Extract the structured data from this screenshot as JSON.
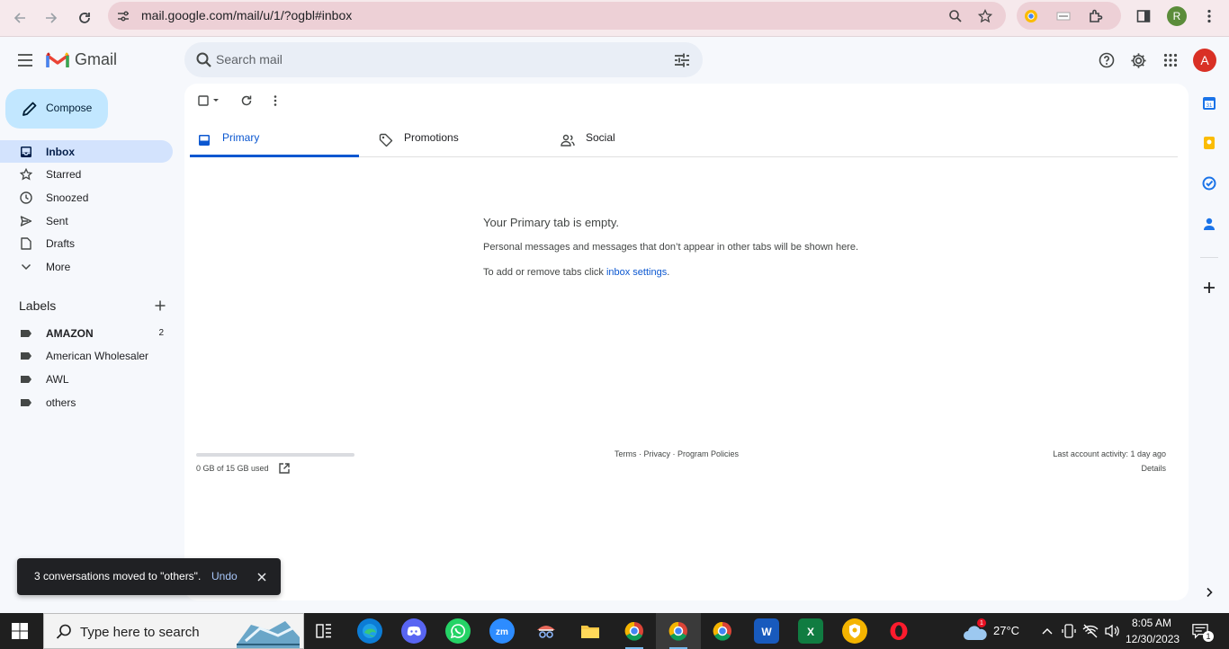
{
  "browser": {
    "url": "mail.google.com/mail/u/1/?ogbl#inbox",
    "profile_initial": "R"
  },
  "header": {
    "app_name": "Gmail",
    "search_placeholder": "Search mail",
    "avatar_initial": "A"
  },
  "compose": {
    "label": "Compose"
  },
  "nav": {
    "items": [
      {
        "label": "Inbox",
        "icon": "inbox-icon",
        "active": true
      },
      {
        "label": "Starred",
        "icon": "star-icon"
      },
      {
        "label": "Snoozed",
        "icon": "clock-icon"
      },
      {
        "label": "Sent",
        "icon": "send-icon"
      },
      {
        "label": "Drafts",
        "icon": "draft-icon"
      },
      {
        "label": "More",
        "icon": "chevron-down-icon"
      }
    ]
  },
  "labels": {
    "heading": "Labels",
    "items": [
      {
        "label": "AMAZON",
        "count": "2",
        "bold": true
      },
      {
        "label": "American Wholesaler"
      },
      {
        "label": "AWL"
      },
      {
        "label": "others"
      }
    ]
  },
  "tabs": [
    {
      "label": "Primary",
      "icon": "inbox-icon",
      "active": true
    },
    {
      "label": "Promotions",
      "icon": "tag-icon"
    },
    {
      "label": "Social",
      "icon": "people-icon"
    }
  ],
  "empty_state": {
    "title": "Your Primary tab is empty.",
    "line1": "Personal messages and messages that don’t appear in other tabs will be shown here.",
    "line2_prefix": "To add or remove tabs click ",
    "line2_link": "inbox settings",
    "line2_suffix": "."
  },
  "footer": {
    "storage_used_fraction": 0,
    "storage_text": "0 GB of 15 GB used",
    "links": "Terms · Privacy · Program Policies",
    "last_activity": "Last account activity: 1 day ago",
    "details": "Details"
  },
  "snackbar": {
    "message": "3 conversations moved to \"others\".",
    "action": "Undo"
  },
  "taskbar": {
    "search_placeholder": "Type here to search",
    "temperature": "27°C",
    "weather_badge": "1",
    "time": "8:05 AM",
    "date": "12/30/2023",
    "notifications": "1",
    "colors": {
      "accent": "#0b57d0",
      "compose": "#c2e7ff",
      "nav_active": "#d3e3fd"
    }
  }
}
